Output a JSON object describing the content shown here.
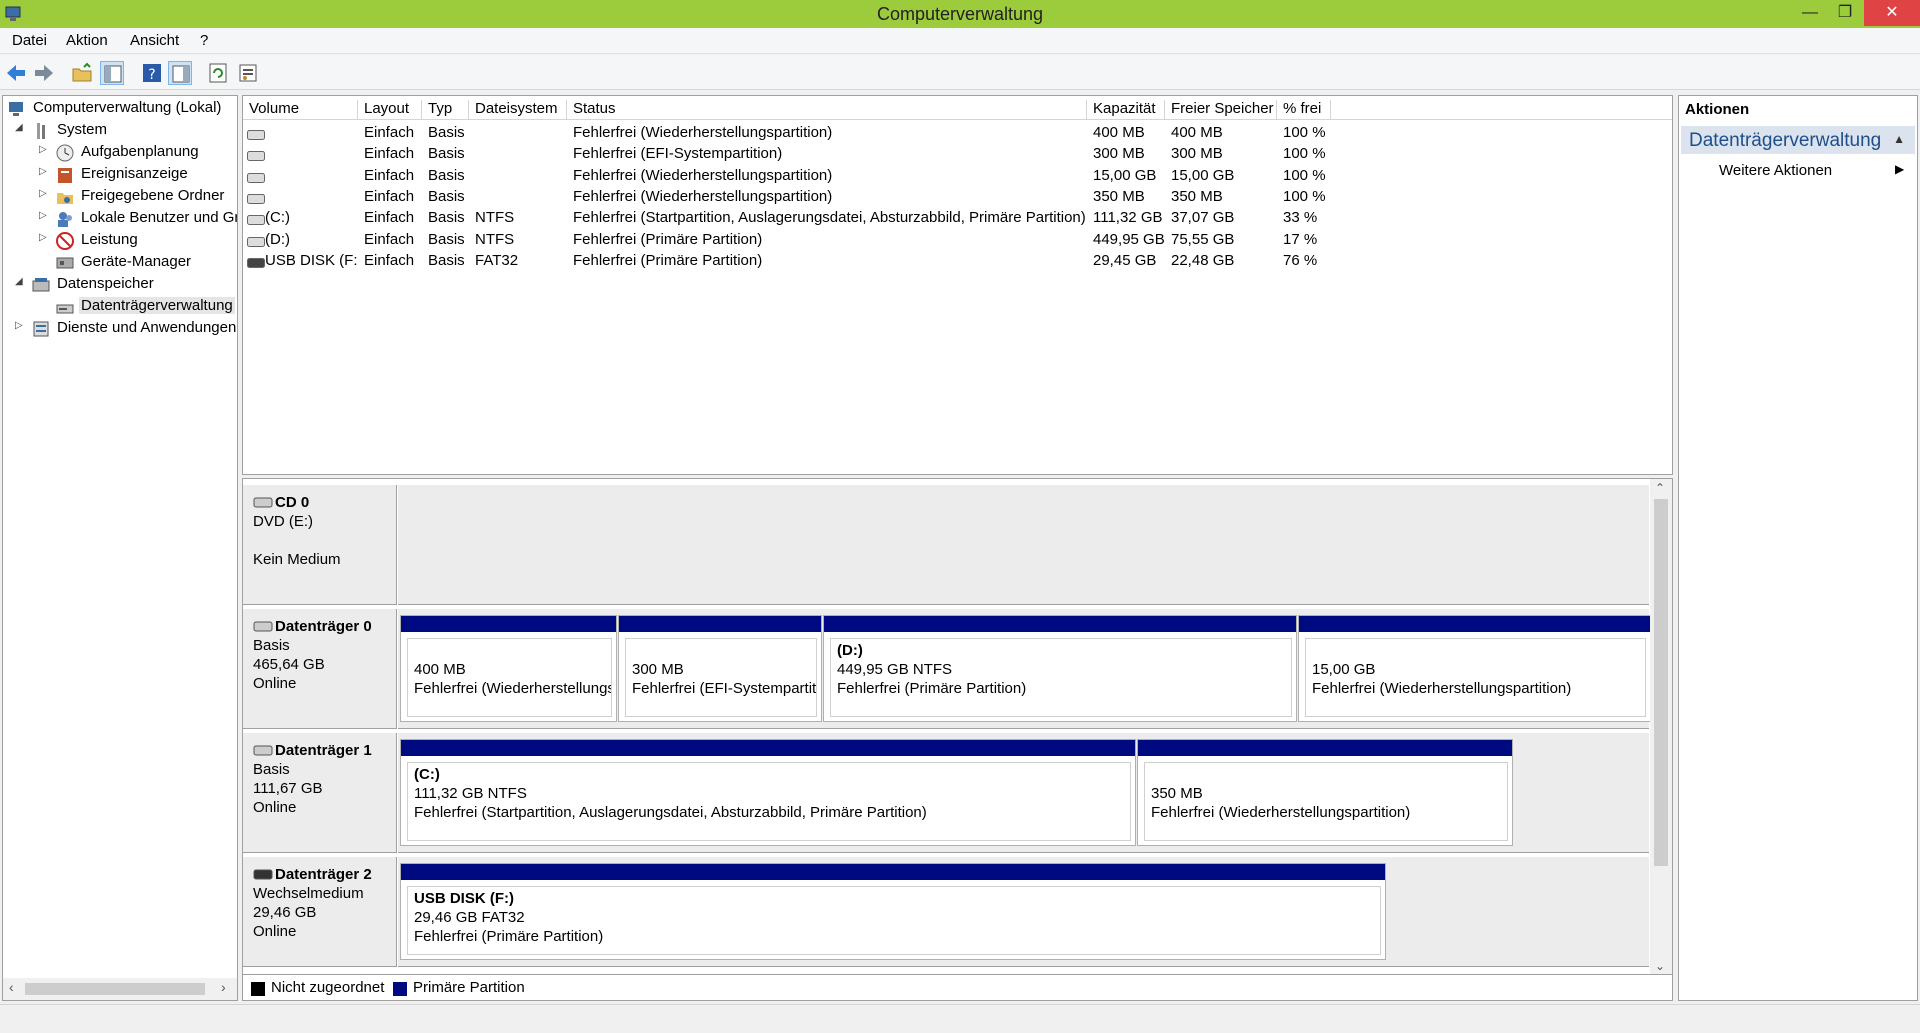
{
  "window": {
    "title": "Computerverwaltung"
  },
  "menu": [
    "Datei",
    "Aktion",
    "Ansicht",
    "?"
  ],
  "tree": {
    "root": "Computerverwaltung (Lokal)",
    "system": "System",
    "system_items": [
      "Aufgabenplanung",
      "Ereignisanzeige",
      "Freigegebene Ordner",
      "Lokale Benutzer und Gr",
      "Leistung",
      "Geräte-Manager"
    ],
    "storage": "Datenspeicher",
    "storage_items": [
      "Datenträgerverwaltung"
    ],
    "services": "Dienste und Anwendungen"
  },
  "volumes": {
    "columns": [
      "Volume",
      "Layout",
      "Typ",
      "Dateisystem",
      "Status",
      "Kapazität",
      "Freier Speicher",
      "% frei"
    ],
    "rows": [
      [
        "",
        "Einfach",
        "Basis",
        "",
        "Fehlerfrei (Wiederherstellungspartition)",
        "400 MB",
        "400 MB",
        "100 %"
      ],
      [
        "",
        "Einfach",
        "Basis",
        "",
        "Fehlerfrei (EFI-Systempartition)",
        "300 MB",
        "300 MB",
        "100 %"
      ],
      [
        "",
        "Einfach",
        "Basis",
        "",
        "Fehlerfrei (Wiederherstellungspartition)",
        "15,00 GB",
        "15,00 GB",
        "100 %"
      ],
      [
        "",
        "Einfach",
        "Basis",
        "",
        "Fehlerfrei (Wiederherstellungspartition)",
        "350 MB",
        "350 MB",
        "100 %"
      ],
      [
        "(C:)",
        "Einfach",
        "Basis",
        "NTFS",
        "Fehlerfrei (Startpartition, Auslagerungsdatei, Absturzabbild, Primäre Partition)",
        "111,32 GB",
        "37,07 GB",
        "33 %"
      ],
      [
        "(D:)",
        "Einfach",
        "Basis",
        "NTFS",
        "Fehlerfrei (Primäre Partition)",
        "449,95 GB",
        "75,55 GB",
        "17 %"
      ],
      [
        "USB DISK (F:)",
        "Einfach",
        "Basis",
        "FAT32",
        "Fehlerfrei (Primäre Partition)",
        "29,45 GB",
        "22,48 GB",
        "76 %"
      ]
    ]
  },
  "disks": [
    {
      "name": "CD 0",
      "lines": [
        "DVD (E:)",
        "",
        "Kein Medium"
      ],
      "partitions": []
    },
    {
      "name": "Datenträger 0",
      "lines": [
        "Basis",
        "465,64 GB",
        "Online"
      ],
      "partitions": [
        {
          "title": "",
          "size": "400 MB",
          "status": "Fehlerfrei (Wiederherstellungs"
        },
        {
          "title": "",
          "size": "300 MB",
          "status": "Fehlerfrei (EFI-Systempartitic"
        },
        {
          "title": "(D:)",
          "size": "449,95 GB NTFS",
          "status": "Fehlerfrei (Primäre Partition)"
        },
        {
          "title": "",
          "size": "15,00 GB",
          "status": "Fehlerfrei (Wiederherstellungspartition)"
        }
      ]
    },
    {
      "name": "Datenträger 1",
      "lines": [
        "Basis",
        "111,67 GB",
        "Online"
      ],
      "partitions": [
        {
          "title": "(C:)",
          "size": "111,32 GB NTFS",
          "status": "Fehlerfrei (Startpartition, Auslagerungsdatei, Absturzabbild, Primäre Partition)"
        },
        {
          "title": "",
          "size": "350 MB",
          "status": "Fehlerfrei (Wiederherstellungspartition)"
        }
      ]
    },
    {
      "name": "Datenträger 2",
      "lines": [
        "Wechselmedium",
        "29,46 GB",
        "Online"
      ],
      "partitions": [
        {
          "title": "USB DISK  (F:)",
          "size": "29,46 GB FAT32",
          "status": "Fehlerfrei (Primäre Partition)"
        }
      ]
    }
  ],
  "legend": [
    {
      "label": "Nicht zugeordnet",
      "color": "#000000"
    },
    {
      "label": "Primäre Partition",
      "color": "#000a80"
    }
  ],
  "actions": {
    "title": "Aktionen",
    "section": "Datenträgerverwaltung",
    "more": "Weitere Aktionen"
  },
  "colors": {
    "titlebar": "#9ccc3c",
    "primary_partition": "#000a80",
    "close": "#e04343"
  }
}
